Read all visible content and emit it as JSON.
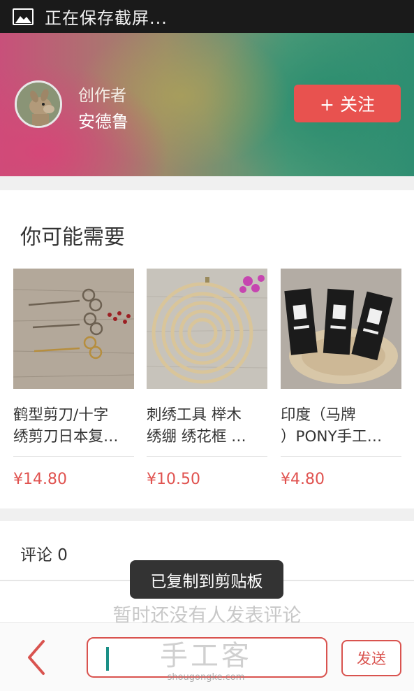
{
  "status_bar": {
    "text": "正在保存截屏..."
  },
  "author": {
    "role": "创作者",
    "name": "安德鲁",
    "follow_label": "+ 关注"
  },
  "suggestions": {
    "title": "你可能需要",
    "items": [
      {
        "name_line1": "鹤型剪刀/十字",
        "name_line2": "绣剪刀日本复…",
        "price": "¥14.80"
      },
      {
        "name_line1": "刺绣工具 榉木",
        "name_line2": "绣绷 绣花框 …",
        "price": "¥10.50"
      },
      {
        "name_line1": "印度（马牌",
        "name_line2": "）PONY手工…",
        "price": "¥4.80"
      }
    ]
  },
  "comments": {
    "label": "评论 0",
    "empty_text": "暂时还没有人发表评论"
  },
  "toast": {
    "text": "已复制到剪贴板"
  },
  "bottom_bar": {
    "input_value": "",
    "send_label": "发送"
  },
  "watermark": {
    "main": "手工客",
    "sub": "shougongke.com"
  },
  "colors": {
    "accent": "#e8524f",
    "status_bar": "#1a1a1a",
    "price": "#e0524f"
  }
}
